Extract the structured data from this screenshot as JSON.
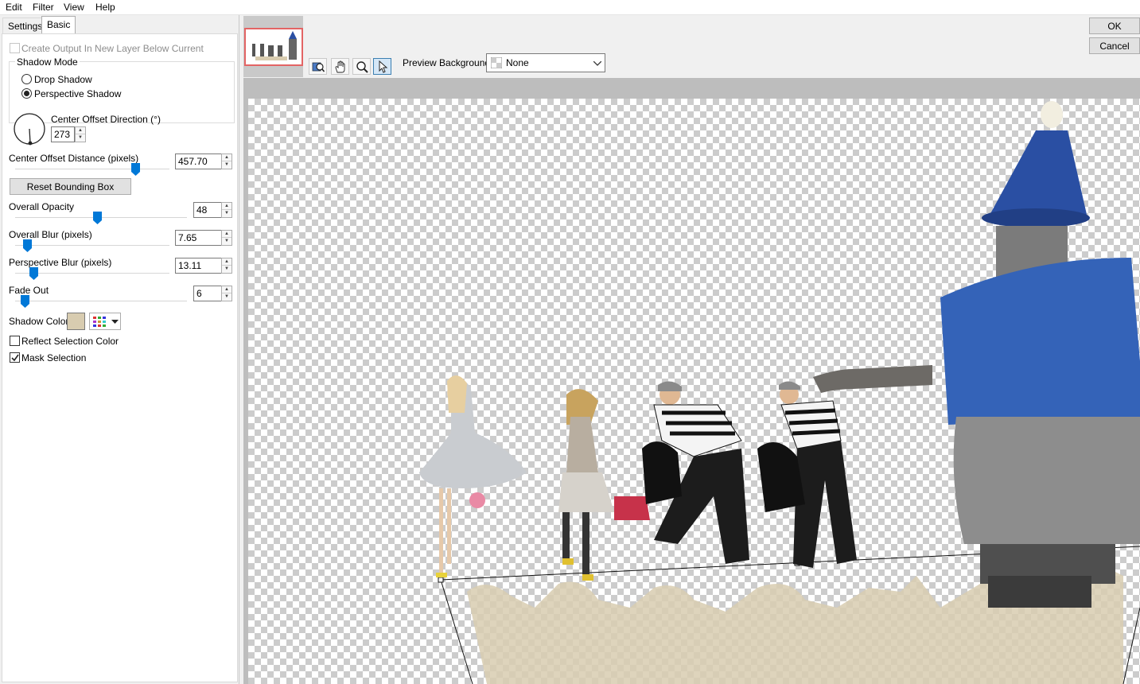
{
  "menu": {
    "edit": "Edit",
    "filter": "Filter",
    "view": "View",
    "help": "Help"
  },
  "tabs": {
    "settings": "Settings",
    "basic": "Basic"
  },
  "options": {
    "create_output": "Create Output In New Layer Below Current",
    "shadow_mode_title": "Shadow Mode",
    "drop_shadow": "Drop Shadow",
    "perspective_shadow": "Perspective Shadow",
    "selected_mode": "Perspective Shadow"
  },
  "controls": {
    "center_offset_direction": {
      "label": "Center Offset Direction (°)",
      "value": "273"
    },
    "center_offset_distance": {
      "label": "Center Offset Distance (pixels)",
      "value": "457.70",
      "level": 0.78
    },
    "reset_bounding_box": "Reset Bounding Box",
    "overall_opacity": {
      "label": "Overall Opacity",
      "value": "48",
      "level": 0.48
    },
    "overall_blur": {
      "label": "Overall Blur (pixels)",
      "value": "7.65",
      "level": 0.08
    },
    "perspective_blur": {
      "label": "Perspective Blur (pixels)",
      "value": "13.11",
      "level": 0.12
    },
    "fade_out": {
      "label": "Fade Out",
      "value": "6",
      "level": 0.06
    },
    "shadow_color": {
      "label": "Shadow Color",
      "color": "#d8ccb0"
    },
    "reflect_selection_color": "Reflect Selection Color",
    "mask_selection": "Mask Selection"
  },
  "toolbar": {
    "preview_background_label": "Preview Background:",
    "preview_background_value": "None",
    "tools": [
      "zoom-fit-icon",
      "hand-icon",
      "magnifier-icon",
      "pointer-icon"
    ]
  },
  "dialog": {
    "ok": "OK",
    "cancel": "Cancel"
  },
  "colors": {
    "accent": "#0078d7",
    "shadow": "#d8ccb0",
    "hat": "#2a4fa3"
  }
}
